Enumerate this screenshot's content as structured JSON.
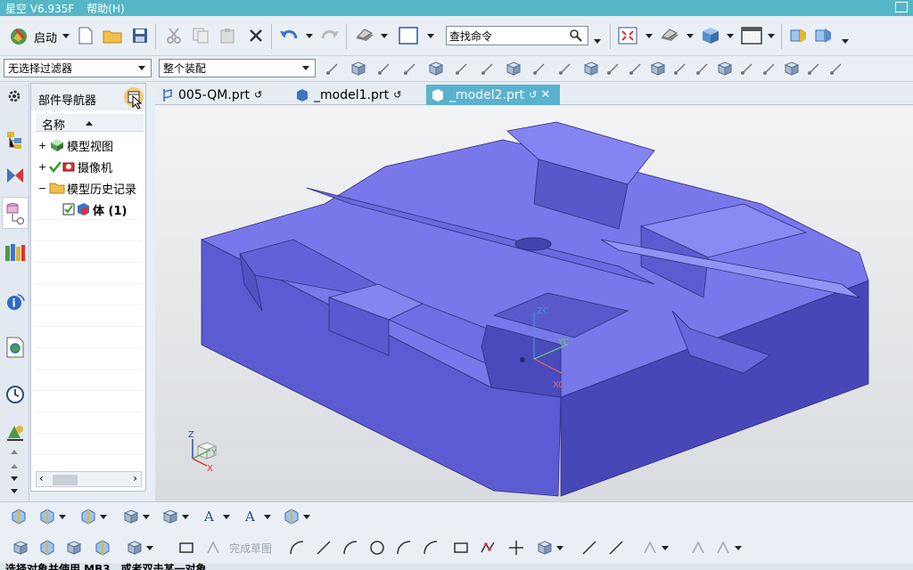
{
  "app": {
    "title": "星空 V6.935F",
    "menu": "帮助(H)"
  },
  "toolbar": {
    "start_label": "启动",
    "search_placeholder": "查找命令"
  },
  "filters": {
    "selection_filter": "无选择过滤器",
    "assembly_scope": "整个装配"
  },
  "navigator": {
    "title": "部件导航器",
    "column_name": "名称",
    "items": [
      {
        "label": "模型视图",
        "expander": "+"
      },
      {
        "label": "摄像机",
        "expander": "+"
      },
      {
        "label": "模型历史记录",
        "expander": "−"
      },
      {
        "label": "体 (1)",
        "expander": ""
      }
    ]
  },
  "tabs": [
    {
      "label": "005-QM.prt",
      "active": false
    },
    {
      "label": "_model1.prt",
      "active": false
    },
    {
      "label": "_model2.prt",
      "active": true
    }
  ],
  "viewport": {
    "axis_zc": "ZC",
    "axis_yc": "YC",
    "axis_xc": "XC",
    "triad_z": "Z",
    "triad_y": "Y",
    "triad_x": "X",
    "model_color": "#6f6fe8",
    "background": "#e6e9ec"
  },
  "sketch": {
    "finish_label": "完成草图"
  },
  "status": {
    "message": "选择对象并使用 MB3，或者双击某一对象"
  }
}
